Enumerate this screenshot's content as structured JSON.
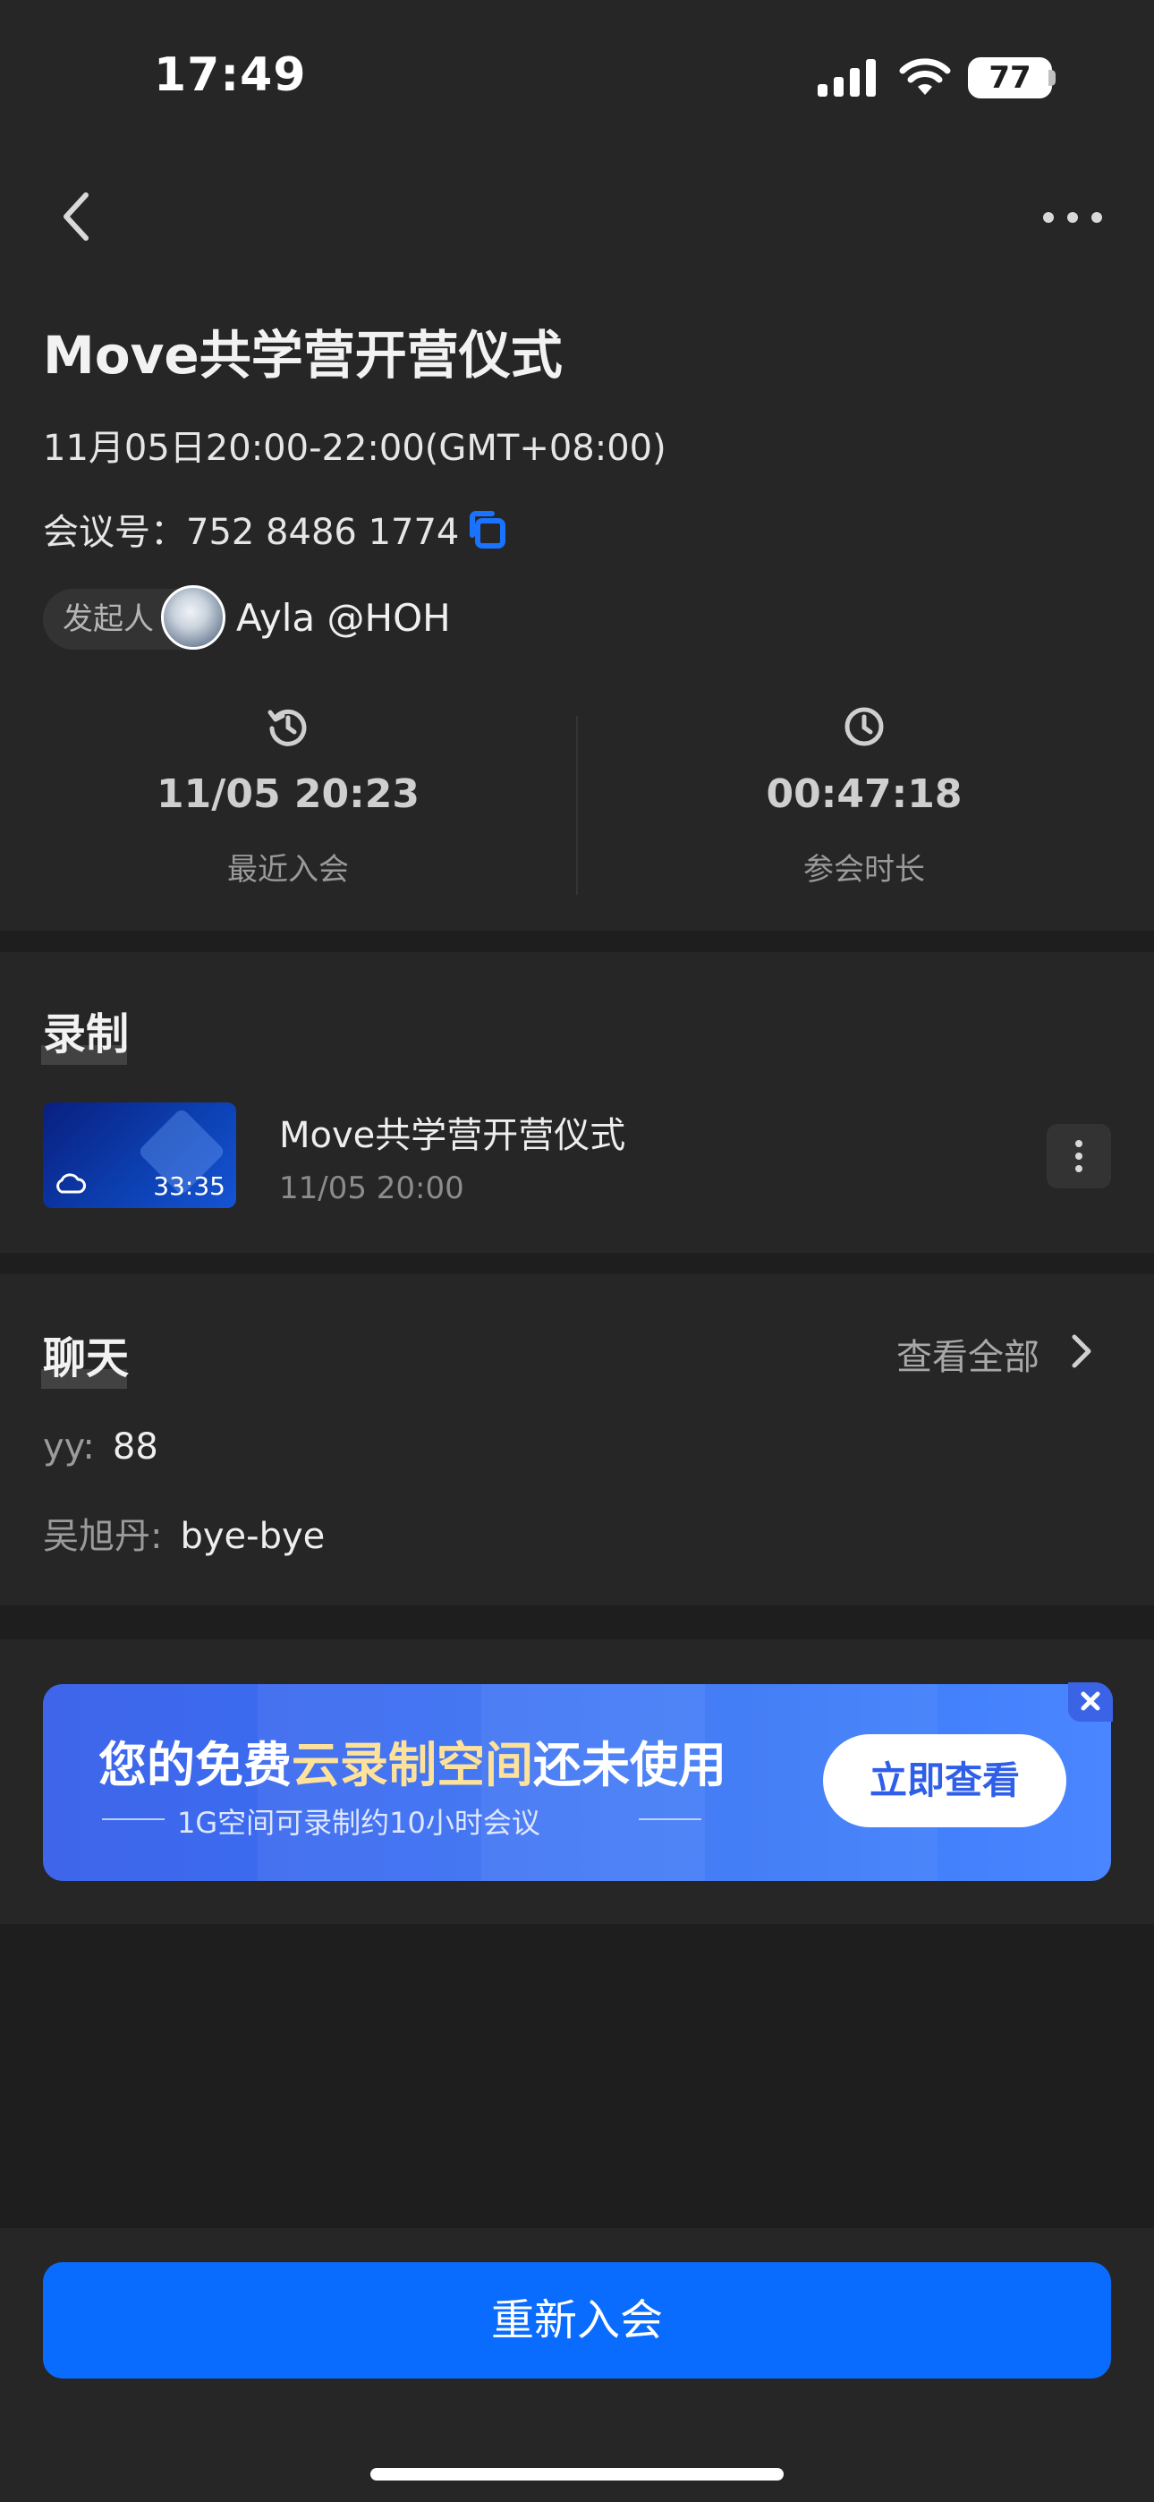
{
  "status_bar": {
    "time": "17:49",
    "battery": "77"
  },
  "meeting": {
    "title": "Move共学营开营仪式",
    "datetime": "11月05日20:00-22:00(GMT+08:00)",
    "id_label": "会议号：752 8486 1774",
    "host_label": "发起人",
    "host_name": "Ayla @HOH"
  },
  "stats": [
    {
      "icon": "history-clock-icon",
      "value": "11/05 20:23",
      "label": "最近入会"
    },
    {
      "icon": "clock-icon",
      "value": "00:47:18",
      "label": "参会时长"
    }
  ],
  "recording": {
    "section_title": "录制",
    "duration": "33:35",
    "title": "Move共学营开营仪式",
    "time": "11/05 20:00"
  },
  "chat": {
    "section_title": "聊天",
    "view_all": "查看全部",
    "messages": [
      {
        "sender": "yy:",
        "text": "88"
      },
      {
        "sender": "吴旭丹:",
        "text": "bye-bye"
      }
    ]
  },
  "banner": {
    "headline_part1": "您的免费",
    "headline_highlight": "云录制空间",
    "headline_part2": "还未使用",
    "subtext": "1G空间可录制约10小时会议",
    "button": "立即查看",
    "colors": {
      "background": "#3a6df2",
      "highlight": "#ffe29a"
    }
  },
  "actions": {
    "rejoin": "重新入会"
  },
  "colors": {
    "accent": "#0a6cff",
    "background": "#1e1e1e",
    "surface": "#262626"
  }
}
